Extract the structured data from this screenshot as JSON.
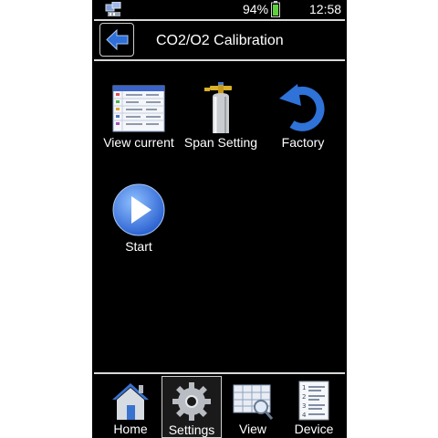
{
  "status": {
    "battery": "94%",
    "time": "12:58"
  },
  "header": {
    "title": "CO2/O2 Calibration"
  },
  "tiles": [
    {
      "label": "View current",
      "icon": "table-icon"
    },
    {
      "label": "Span Setting",
      "icon": "gas-cylinder-icon"
    },
    {
      "label": "Factory",
      "icon": "undo-icon"
    },
    {
      "label": "Start",
      "icon": "play-icon"
    }
  ],
  "nav": [
    {
      "label": "Home",
      "icon": "home-icon"
    },
    {
      "label": "Settings",
      "icon": "gear-icon",
      "selected": true
    },
    {
      "label": "View",
      "icon": "view-table-icon"
    },
    {
      "label": "Device",
      "icon": "device-list-icon"
    }
  ],
  "colors": {
    "background": "#000000",
    "accent_blue": "#2f6fe0",
    "separator": "#d8d8d8"
  }
}
